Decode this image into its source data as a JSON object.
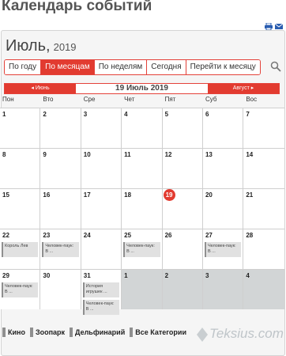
{
  "page": {
    "title": "Календарь событий"
  },
  "header": {
    "month": "Июль,",
    "year": "2019"
  },
  "icons": {
    "print": "print-icon",
    "email": "email-icon",
    "search": "search-icon"
  },
  "views": [
    {
      "label": "По году",
      "active": false
    },
    {
      "label": "По месяцам",
      "active": true
    },
    {
      "label": "По неделям",
      "active": false
    },
    {
      "label": "Сегодня",
      "active": false
    },
    {
      "label": "Перейти к месяцу",
      "active": false
    }
  ],
  "nav": {
    "prev": "◂ Июнь",
    "current": "19 Июль 2019",
    "next": "Август ▸"
  },
  "weekdays": [
    "Пон",
    "Вто",
    "Сре",
    "Чет",
    "Пят",
    "Суб",
    "Вос"
  ],
  "weeks": [
    [
      {
        "day": "1"
      },
      {
        "day": "2"
      },
      {
        "day": "3"
      },
      {
        "day": "4"
      },
      {
        "day": "5"
      },
      {
        "day": "6"
      },
      {
        "day": "7"
      }
    ],
    [
      {
        "day": "8"
      },
      {
        "day": "9"
      },
      {
        "day": "10"
      },
      {
        "day": "11"
      },
      {
        "day": "12"
      },
      {
        "day": "13"
      },
      {
        "day": "14"
      }
    ],
    [
      {
        "day": "15"
      },
      {
        "day": "16"
      },
      {
        "day": "17"
      },
      {
        "day": "18"
      },
      {
        "day": "19",
        "today": true
      },
      {
        "day": "20"
      },
      {
        "day": "21"
      }
    ],
    [
      {
        "day": "22",
        "events": [
          "Король Лев"
        ]
      },
      {
        "day": "23",
        "events": [
          "Человек-паук: В ..."
        ]
      },
      {
        "day": "24"
      },
      {
        "day": "25",
        "events": [
          "Человек-паук: В ..."
        ]
      },
      {
        "day": "26"
      },
      {
        "day": "27",
        "events": [
          "Человек-паук: В ..."
        ]
      },
      {
        "day": "28"
      }
    ],
    [
      {
        "day": "29",
        "events": [
          "Человек-паук: В ..."
        ]
      },
      {
        "day": "30"
      },
      {
        "day": "31",
        "events": [
          "История игрушек ...",
          "Человек-паук: В ..."
        ]
      },
      {
        "day": "1",
        "other": true
      },
      {
        "day": "2",
        "other": true
      },
      {
        "day": "3",
        "other": true
      },
      {
        "day": "4",
        "other": true
      }
    ]
  ],
  "legend": [
    "Кино",
    "Зоопарк",
    "Дельфинарий",
    "Все Категории"
  ],
  "watermark": "Teksius.com",
  "colors": {
    "accent": "#e23b30",
    "other_month": "#d2d5d6",
    "event_bg": "#e1e1e1",
    "event_border": "#8f8f8f"
  }
}
